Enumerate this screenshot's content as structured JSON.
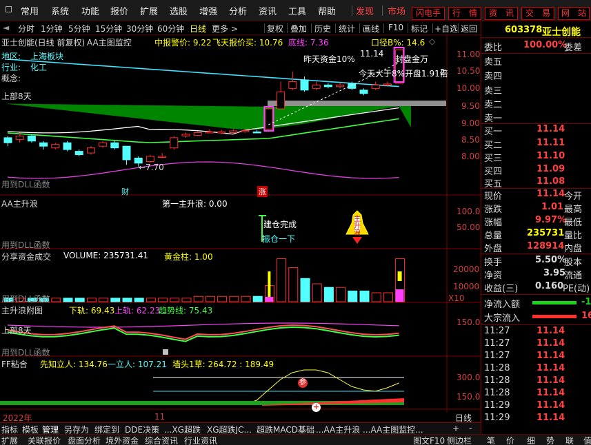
{
  "menu": {
    "items": [
      "常用",
      "系统",
      "功能",
      "报价",
      "扩展",
      "选股",
      "增强",
      "分析",
      "资讯",
      "工具",
      "帮助"
    ],
    "red": [
      "发现",
      "市场"
    ],
    "right_buttons": [
      "闪电手",
      "行　情",
      "资　讯",
      "交　易",
      "网　站"
    ]
  },
  "toolbar": {
    "left": [
      "分时",
      "1分钟",
      "5分钟",
      "15分钟",
      "30分钟",
      "60分钟",
      "日线",
      "更多 >"
    ],
    "right": [
      "复权",
      "叠加",
      "历史",
      "统计",
      "画线",
      "F10",
      "标记",
      "+自选",
      "返回"
    ]
  },
  "stock": {
    "code": "603378",
    "name": "亚士创能"
  },
  "main_panel": {
    "title": "亚士创能(日线 前复权)",
    "indicator": "AA主图监控",
    "warn_label": "中报警价: 9.22",
    "fly_label": "飞天报价买: 10.76",
    "bottom_label": "底线: 7.36",
    "radius": "口径B%: 14.6",
    "area": "地区:",
    "area_val": "上海板块",
    "industry": "行业:",
    "industry_val": "化工",
    "concept": "概念:",
    "note1": "昨天资金10%",
    "note2": "封盘金万",
    "note3": "今天大于8%开盘1.91倍",
    "pct": "2",
    "high": "11.14",
    "low": "←7.70",
    "upper_tag": "上部8天",
    "dll": "用到DLL函数",
    "fin_tag": "财",
    "up_tag": "涨",
    "y_ticks": [
      "11.00",
      "10.50",
      "10.00",
      "9.50",
      "9.00",
      "8.50",
      "8.00"
    ]
  },
  "p2": {
    "title": "AA主升浪",
    "sub": "第一主升浪: 0.00",
    "ticks": [
      "100.0",
      "50.00"
    ],
    "tag1": "建仓完成",
    "tag2": "振仓一下",
    "bell": "主升浪",
    "dll": "用到DLL函数"
  },
  "p3": {
    "title": "分享资金成交",
    "vol": "VOLUME: 235731.41",
    "gold": "黄金柱: 1.00",
    "ticks": [
      "20000",
      "10000"
    ],
    "unit": "X10",
    "dll": "用到DLL函数"
  },
  "p4": {
    "title": "主升浪附图",
    "down": "下轨: 69.43",
    "up": "上轨: 62.23",
    "trend": "趋势线: 75.43",
    "tick": "150.0",
    "upper_tag": "上部8天",
    "dll": "用到DLL函数"
  },
  "p5": {
    "title": "FF粘合",
    "a": "先知立人: 134.76",
    "b": "一立人: 107.21",
    "c": "墙头1草: 264.72 : 189.49",
    "ticks": [
      "300.0",
      "150.0"
    ],
    "tag_sell": "参"
  },
  "xaxis": {
    "year": "2022年",
    "mid": "11",
    "period": "日线"
  },
  "tabs": [
    "指标",
    "模板",
    "管理",
    "另存为",
    "绑定到",
    "DDE决策",
    "...XG超跌",
    "XG超跌JC...",
    "超跌MACD基础",
    "...AA主升浪",
    "...AA主图监控..."
  ],
  "tabs_right": [
    "+",
    "-"
  ],
  "bottombar": [
    "扩展",
    "关联报价",
    "盘面分析",
    "境外资金",
    "综合资讯",
    "行业资讯"
  ],
  "bottombar_right": [
    "图文F10",
    "侧边栏",
    "笔",
    "价",
    "细",
    "势",
    "联",
    "值"
  ],
  "right": {
    "weibi_label": "委比",
    "weibi": "100.00%",
    "weicha": "委差",
    "sells": [
      {
        "l": "卖五",
        "p": ""
      },
      {
        "l": "卖四",
        "p": ""
      },
      {
        "l": "卖三",
        "p": ""
      },
      {
        "l": "卖二",
        "p": ""
      },
      {
        "l": "卖一",
        "p": ""
      }
    ],
    "buys": [
      {
        "l": "买一",
        "p": "11.14"
      },
      {
        "l": "买二",
        "p": "11.11"
      },
      {
        "l": "买三",
        "p": "11.10"
      },
      {
        "l": "买四",
        "p": "11.09"
      },
      {
        "l": "买五",
        "p": "11.08"
      }
    ],
    "stats": [
      {
        "l": "现价",
        "v": "11.14",
        "r": "今开"
      },
      {
        "l": "涨跌",
        "v": "1.01",
        "r": "最高"
      },
      {
        "l": "涨幅",
        "v": "9.97%",
        "r": "最低"
      },
      {
        "l": "总量",
        "v": "235731",
        "r": "量比"
      },
      {
        "l": "外盘",
        "v": "128914",
        "r": "内盘"
      }
    ],
    "stats2": [
      {
        "l": "换手",
        "v": "5.50%",
        "r": "股本"
      },
      {
        "l": "净资",
        "v": "3.95",
        "r": "流通"
      },
      {
        "l": "收益(三)",
        "v": "0.160",
        "r": "PE(动)"
      }
    ],
    "flow": [
      {
        "l": "净流入额",
        "v": "-13"
      },
      {
        "l": "大宗流入",
        "v": "16"
      }
    ],
    "ticks": [
      {
        "t": "11:27",
        "p": "11.14"
      },
      {
        "t": "11:27",
        "p": "11.14"
      },
      {
        "t": "11:27",
        "p": "11.14"
      },
      {
        "t": "11:28",
        "p": "11.14"
      },
      {
        "t": "11:28",
        "p": "11.14"
      },
      {
        "t": "11:28",
        "p": "11.14"
      },
      {
        "t": "11:29",
        "p": "11.14"
      },
      {
        "t": "11:29",
        "p": "11.14"
      }
    ]
  },
  "candles": [
    {
      "o": 8.55,
      "c": 8.4,
      "h": 8.6,
      "l": 8.3
    },
    {
      "o": 8.5,
      "c": 8.6,
      "h": 8.7,
      "l": 8.4
    },
    {
      "o": 8.6,
      "c": 8.45,
      "h": 8.65,
      "l": 8.4
    },
    {
      "o": 8.4,
      "c": 8.3,
      "h": 8.45,
      "l": 8.2
    },
    {
      "o": 8.25,
      "c": 8.35,
      "h": 8.4,
      "l": 8.2
    },
    {
      "o": 8.4,
      "c": 8.2,
      "h": 8.45,
      "l": 8.15
    },
    {
      "o": 8.15,
      "c": 8.05,
      "h": 8.2,
      "l": 8.0
    },
    {
      "o": 8.1,
      "c": 8.25,
      "h": 8.3,
      "l": 8.05
    },
    {
      "o": 8.3,
      "c": 8.4,
      "h": 8.45,
      "l": 8.25
    },
    {
      "o": 8.4,
      "c": 8.25,
      "h": 8.45,
      "l": 8.2
    },
    {
      "o": 8.3,
      "c": 7.9,
      "h": 8.3,
      "l": 7.75
    },
    {
      "o": 7.95,
      "c": 7.8,
      "h": 8.0,
      "l": 7.7
    },
    {
      "o": 7.85,
      "c": 8.0,
      "h": 8.05,
      "l": 7.8
    },
    {
      "o": 8.0,
      "c": 8.0,
      "h": 8.1,
      "l": 7.95
    },
    {
      "o": 8.25,
      "c": 8.55,
      "h": 8.6,
      "l": 8.2
    },
    {
      "o": 8.6,
      "c": 8.65,
      "h": 8.7,
      "l": 8.55
    },
    {
      "o": 8.62,
      "c": 8.7,
      "h": 8.75,
      "l": 8.6
    },
    {
      "o": 8.72,
      "c": 8.72,
      "h": 8.8,
      "l": 8.68
    },
    {
      "o": 8.7,
      "c": 8.72,
      "h": 8.78,
      "l": 8.65
    },
    {
      "o": 8.7,
      "c": 8.75,
      "h": 8.8,
      "l": 8.68
    },
    {
      "o": 8.72,
      "c": 8.76,
      "h": 8.8,
      "l": 8.7
    },
    {
      "o": 8.72,
      "c": 8.7,
      "h": 8.78,
      "l": 8.68
    },
    {
      "o": 8.8,
      "c": 9.4,
      "h": 9.45,
      "l": 8.8
    },
    {
      "o": 9.4,
      "c": 9.9,
      "h": 10.2,
      "l": 9.4
    },
    {
      "o": 10.0,
      "c": 10.2,
      "h": 10.5,
      "l": 9.95
    },
    {
      "o": 10.25,
      "c": 9.95,
      "h": 10.35,
      "l": 9.9
    },
    {
      "o": 10.0,
      "c": 10.1,
      "h": 10.2,
      "l": 9.95
    },
    {
      "o": 10.1,
      "c": 10.05,
      "h": 10.15,
      "l": 10.0
    },
    {
      "o": 10.05,
      "c": 10.1,
      "h": 10.15,
      "l": 10.0
    },
    {
      "o": 10.15,
      "c": 10.0,
      "h": 10.2,
      "l": 9.95
    },
    {
      "o": 9.95,
      "c": 9.85,
      "h": 10.0,
      "l": 9.8
    },
    {
      "o": 10.0,
      "c": 10.1,
      "h": 10.2,
      "l": 9.95
    },
    {
      "o": 10.1,
      "c": 10.13,
      "h": 10.2,
      "l": 10.05
    },
    {
      "o": 10.15,
      "c": 11.14,
      "h": 11.14,
      "l": 10.15
    }
  ],
  "volumes": [
    2,
    2,
    2,
    2,
    2,
    2,
    2,
    2,
    2,
    2,
    2,
    2,
    2,
    2,
    2,
    2,
    3,
    3,
    3,
    3,
    3,
    3,
    9,
    24,
    19,
    13,
    10,
    8,
    8,
    6,
    6,
    5,
    5,
    24
  ],
  "colors": {
    "up": "#ff3030",
    "down": "#54ffff",
    "grid": "#800000",
    "green_band": "#008c00",
    "label_yellow": "#ffff00"
  }
}
